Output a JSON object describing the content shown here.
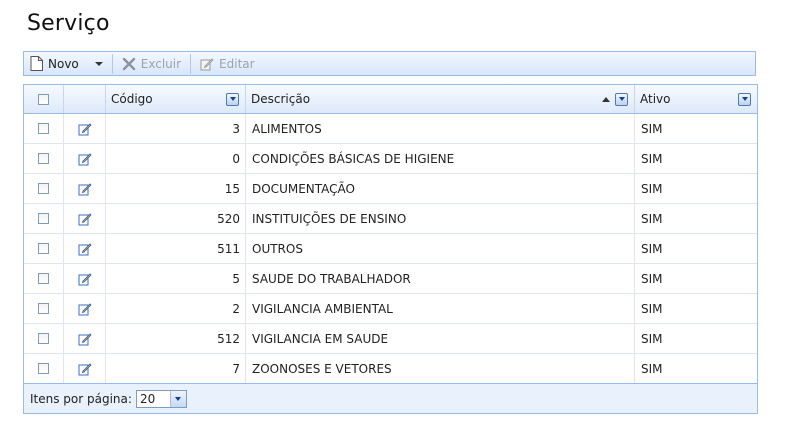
{
  "page": {
    "title": "Serviço"
  },
  "toolbar": {
    "novo_label": "Novo",
    "excluir_label": "Excluir",
    "editar_label": "Editar"
  },
  "grid": {
    "columns": {
      "codigo": "Código",
      "descricao": "Descrição",
      "ativo": "Ativo"
    },
    "rows": [
      {
        "codigo": "3",
        "descricao": "ALIMENTOS",
        "ativo": "SIM"
      },
      {
        "codigo": "0",
        "descricao": "CONDIÇÕES BÁSICAS DE HIGIENE",
        "ativo": "SIM"
      },
      {
        "codigo": "15",
        "descricao": "DOCUMENTAÇÃO",
        "ativo": "SIM"
      },
      {
        "codigo": "520",
        "descricao": "INSTITUIÇÕES DE ENSINO",
        "ativo": "SIM"
      },
      {
        "codigo": "511",
        "descricao": "OUTROS",
        "ativo": "SIM"
      },
      {
        "codigo": "5",
        "descricao": "SAUDE DO TRABALHADOR",
        "ativo": "SIM"
      },
      {
        "codigo": "2",
        "descricao": "VIGILANCIA AMBIENTAL",
        "ativo": "SIM"
      },
      {
        "codigo": "512",
        "descricao": "VIGILANCIA EM SAUDE",
        "ativo": "SIM"
      },
      {
        "codigo": "7",
        "descricao": "ZOONOSES E VETORES",
        "ativo": "SIM"
      }
    ]
  },
  "footer": {
    "items_per_page_label": "Itens por página:",
    "items_per_page_value": "20"
  },
  "colors": {
    "border": "#99bbe8",
    "header_bg": "#dde9f9",
    "edit_icon": "#3a6fc4"
  },
  "icons": {
    "novo": "document-icon",
    "excluir": "x-icon",
    "editar": "pencil-icon",
    "row_edit": "edit-icon"
  }
}
